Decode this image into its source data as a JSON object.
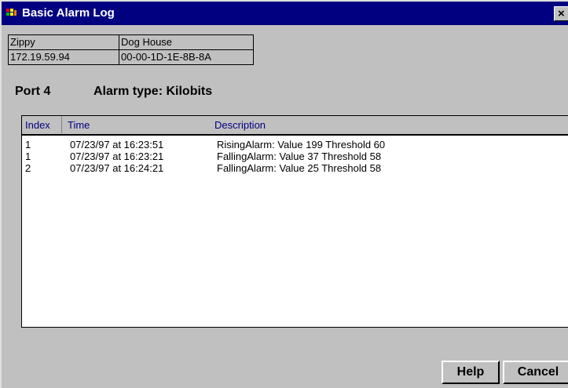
{
  "window": {
    "title": "Basic Alarm Log",
    "close_label": "×"
  },
  "info_table": {
    "rows": [
      [
        "Zippy",
        "Dog House"
      ],
      [
        "172.19.59.94",
        "00-00-1D-1E-8B-8A"
      ]
    ]
  },
  "port_line": {
    "port": "Port 4",
    "alarm_type": "Alarm type: Kilobits"
  },
  "list": {
    "columns": [
      "Index",
      "Time",
      "Description"
    ],
    "rows": [
      {
        "index": "1",
        "time": "07/23/97 at 16:23:51",
        "description": "RisingAlarm: Value 199  Threshold 60"
      },
      {
        "index": "1",
        "time": "07/23/97 at 16:23:21",
        "description": "FallingAlarm: Value 37  Threshold 58"
      },
      {
        "index": "2",
        "time": "07/23/97 at 16:24:21",
        "description": "FallingAlarm: Value 25  Threshold 58"
      }
    ]
  },
  "buttons": {
    "help": "Help",
    "cancel": "Cancel"
  },
  "colors": {
    "titlebar": "#000080",
    "dialog": "#c0c0c0",
    "header_text": "#000080"
  },
  "icons": {
    "app": "alarm-log-app-icon",
    "close": "close-icon"
  }
}
